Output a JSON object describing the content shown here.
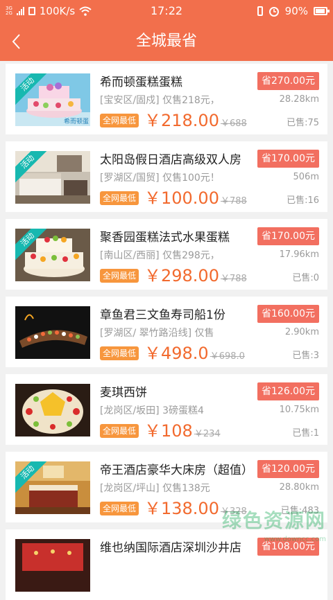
{
  "status_bar": {
    "network_labels": [
      "3G",
      "2G"
    ],
    "speed": "100K/s",
    "time": "17:22",
    "battery": "90%"
  },
  "header": {
    "title": "全城最省",
    "back_icon": "chevron-left-icon"
  },
  "items": [
    {
      "name": "希而顿蛋糕蛋糕",
      "save": "省270.00元",
      "desc": "[宝安区/固戍] 仅售218元，",
      "distance": "28.28km",
      "tag": "全网最低",
      "price": "￥218.00",
      "original": "￥688",
      "sold": "已售:75",
      "ribbon": "活动",
      "has_ribbon": true
    },
    {
      "name": "太阳岛假日酒店高级双人房",
      "save": "省170.00元",
      "desc": "[罗湖区/国贸] 仅售100元！",
      "distance": "506m",
      "tag": "全网最低",
      "price": "￥100.00",
      "original": "￥788",
      "sold": "已售:16",
      "ribbon": "活动",
      "has_ribbon": true
    },
    {
      "name": "聚香园蛋糕法式水果蛋糕",
      "save": "省170.00元",
      "desc": "[南山区/西丽] 仅售298元，",
      "distance": "17.96km",
      "tag": "全网最低",
      "price": "￥298.00",
      "original": "￥788",
      "sold": "已售:0",
      "ribbon": "活动",
      "has_ribbon": true
    },
    {
      "name": "章鱼君三文鱼寿司船1份",
      "save": "省160.00元",
      "desc": "[罗湖区/ 翠竹路沿线] 仅售",
      "distance": "2.90km",
      "tag": "全网最低",
      "price": "￥498.0",
      "original": "￥698.0",
      "sold": "已售:3",
      "ribbon": "",
      "has_ribbon": false
    },
    {
      "name": "麦琪西饼",
      "save": "省126.00元",
      "desc": "[龙岗区/坂田] 3磅蛋糕4",
      "distance": "10.75km",
      "tag": "全网最低",
      "price": "￥108",
      "original": "￥234",
      "sold": "已售:1",
      "ribbon": "",
      "has_ribbon": false
    },
    {
      "name": "帝王酒店豪华大床房（超值）",
      "save": "省120.00元",
      "desc": "[龙岗区/坪山] 仅售138元",
      "distance": "28.80km",
      "tag": "全网最低",
      "price": "￥138.00",
      "original": "￥328",
      "sold": "已售:483",
      "ribbon": "活动",
      "has_ribbon": true
    },
    {
      "name": "维也纳国际酒店深圳沙井店",
      "save": "省108.00元",
      "desc": "",
      "distance": "",
      "tag": "",
      "price": "",
      "original": "",
      "sold": "",
      "ribbon": "",
      "has_ribbon": false
    }
  ],
  "watermark": {
    "text": "绿色资源网",
    "sub": "www.downcc.com"
  }
}
